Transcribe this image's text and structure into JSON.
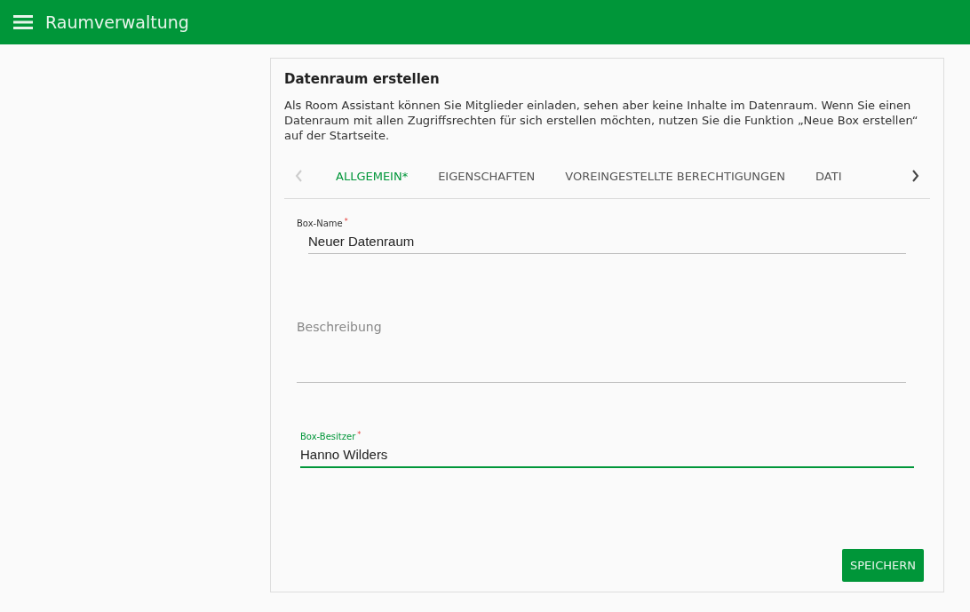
{
  "app_bar": {
    "title": "Raumverwaltung"
  },
  "card": {
    "title": "Datenraum erstellen",
    "description": "Als Room Assistant können Sie Mitglieder einladen, sehen aber keine Inhalte im Datenraum. Wenn Sie einen Datenraum mit allen Zugriffsrechten für sich erstellen möchten, nutzen Sie die Funktion „Neue Box erstellen“ auf der Startseite."
  },
  "tab_scroller": {
    "prev_disabled": true,
    "next_disabled": false
  },
  "tabs": [
    {
      "label": "ALLGEMEIN*",
      "selected": true
    },
    {
      "label": "EIGENSCHAFTEN",
      "selected": false
    },
    {
      "label": "VOREINGESTELLTE BERECHTIGUNGEN",
      "selected": false
    },
    {
      "label": "DATI",
      "selected": false
    }
  ],
  "fields": [
    {
      "kind": "input",
      "label": "Box-Name",
      "required_mark": "*",
      "value": "Neuer Datenraum",
      "focused": false
    },
    {
      "kind": "textarea",
      "placeholder": "Beschreibung",
      "focused": false
    },
    {
      "kind": "input",
      "label": "Box-Besitzer",
      "required_mark": "*",
      "value": "Hanno Wilders",
      "focused": true
    }
  ],
  "buttons": [
    {
      "label": "SPEICHERN"
    }
  ]
}
